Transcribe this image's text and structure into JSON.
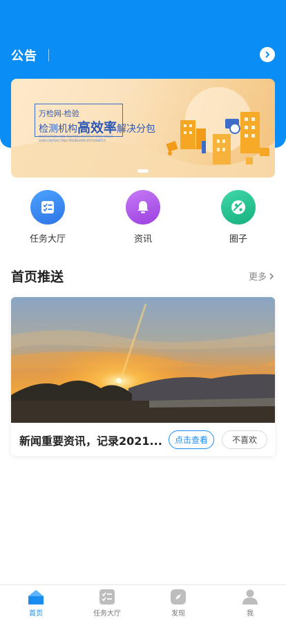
{
  "notice": {
    "title": "公告"
  },
  "banner": {
    "subtitle": "万检网-检验",
    "main_part1": "检测机构",
    "main_part2": "高效率",
    "main_part3": "解决分包",
    "english": "INSPECTION AND TESTING INSTITUTIONS SOLVE SUBCONTRACTING PROBLEMS EFFICIENTLY"
  },
  "quick_menu": [
    {
      "label": "任务大厅",
      "icon": "task-list-icon",
      "color": "#2f80ec"
    },
    {
      "label": "资讯",
      "icon": "bell-icon",
      "color": "#a34ee6"
    },
    {
      "label": "圈子",
      "icon": "circle-icon",
      "color": "#27c08f"
    }
  ],
  "section": {
    "title": "首页推送",
    "more": "更多"
  },
  "news": {
    "title": "新闻重要资讯，记录2021...",
    "view_label": "点击查看",
    "dislike_label": "不喜欢"
  },
  "tabbar": [
    {
      "label": "首页",
      "icon": "home-icon",
      "active": true
    },
    {
      "label": "任务大厅",
      "icon": "task-list-icon",
      "active": false
    },
    {
      "label": "发现",
      "icon": "discover-icon",
      "active": false
    },
    {
      "label": "我",
      "icon": "user-icon",
      "active": false
    }
  ],
  "colors": {
    "primary": "#0a8ef6",
    "accent": "#1a8cf0"
  }
}
